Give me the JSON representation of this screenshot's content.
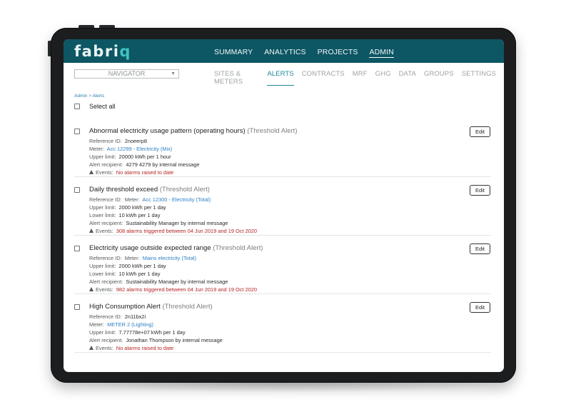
{
  "app": {
    "logo_prefix": "fabri",
    "logo_suffix": "q"
  },
  "topnav": [
    {
      "label": "SUMMARY",
      "active": false
    },
    {
      "label": "ANALYTICS",
      "active": false
    },
    {
      "label": "PROJECTS",
      "active": false
    },
    {
      "label": "ADMIN",
      "active": true
    }
  ],
  "navigator": {
    "label": "NAVIGATOR"
  },
  "subnav": [
    {
      "label": "SITES & METERS",
      "active": false
    },
    {
      "label": "ALERTS",
      "active": true
    },
    {
      "label": "CONTRACTS",
      "active": false
    },
    {
      "label": "MRF",
      "active": false
    },
    {
      "label": "GHG",
      "active": false
    },
    {
      "label": "DATA",
      "active": false
    },
    {
      "label": "GROUPS",
      "active": false
    },
    {
      "label": "SETTINGS",
      "active": false
    }
  ],
  "breadcrumb": {
    "root": "Admin",
    "separator": ">",
    "current": "Alerts"
  },
  "select_all": "Select all",
  "edit_label": "Edit",
  "alerts": [
    {
      "name": "Abnormal electricity usage pattern (operating hours)",
      "type": "(Threshold Alert)",
      "ref_label": "Reference ID:",
      "ref_value": "2noeerp8",
      "meter_label": "Meter:",
      "meter_value": "Acc 12299 - Electricity (Mix)",
      "upper_label": "Upper limit:",
      "upper_value": "20000 kWh per 1 hour",
      "recipient_label": "Alert recipient:",
      "recipient_value": "4279 4279 by internal message",
      "events_label": "Events:",
      "events_value": "No alarms raised to date"
    },
    {
      "name": "Daily threshold exceed",
      "type": "(Threshold Alert)",
      "ref_label": "Reference ID:",
      "meter_label": "Meter:",
      "meter_value": "Acc 12300 - Electricity (Total)",
      "upper_label": "Upper limit:",
      "upper_value": "2000 kWh per 1 day",
      "lower_label": "Lower limit:",
      "lower_value": "10 kWh per 1 day",
      "recipient_label": "Alert recipient:",
      "recipient_value": "Sustainability Manager by internal message",
      "events_label": "Events:",
      "events_value": "308 alarms triggered between 04 Jun 2019 and 19 Oct 2020"
    },
    {
      "name": "Electricity usage outside expected range",
      "type": "(Threshold Alert)",
      "ref_label": "Reference ID:",
      "meter_label": "Meter:",
      "meter_value": "Mains electricity (Total)",
      "upper_label": "Upper limit:",
      "upper_value": "2000 kWh per 1 day",
      "lower_label": "Lower limit:",
      "lower_value": "10 kWh per 1 day",
      "recipient_label": "Alert recipient:",
      "recipient_value": "Sustainability Manager by internal message",
      "events_label": "Events:",
      "events_value": "982 alarms triggered between 04 Jun 2019 and 19 Oct 2020"
    },
    {
      "name": "High Consumption Alert",
      "type": "(Threshold Alert)",
      "ref_label": "Reference ID:",
      "ref_value": "2n11bx2i",
      "meter_label": "Meter:",
      "meter_value": "METER 2 (Lighting)",
      "upper_label": "Upper limit:",
      "upper_value": "7.77778e+07 kWh per 1 day",
      "recipient_label": "Alert recipient:",
      "recipient_value": "Jonathan Thompson by internal message",
      "events_label": "Events:",
      "events_value": "No alarms raised to date"
    }
  ],
  "colors": {
    "header": "#0d5664",
    "accent": "#1f8aa0",
    "link": "#2c7fc4",
    "alarm": "#b52424",
    "device": "#1c1d1f"
  }
}
